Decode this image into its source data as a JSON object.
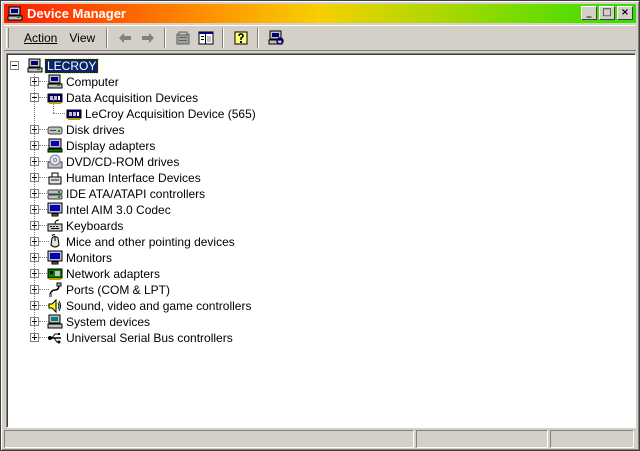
{
  "window": {
    "title": "Device Manager",
    "buttons": {
      "minimize": "_",
      "maximize": "□",
      "close": "×"
    }
  },
  "menu": [
    {
      "label": "Action"
    },
    {
      "label": "View"
    }
  ],
  "toolbar": {
    "tools": [
      "back-arrow-icon",
      "forward-arrow-icon",
      "properties-icon",
      "tree-view-icon",
      "help-icon",
      "scan-hardware-icon"
    ]
  },
  "tree": {
    "root": {
      "label": "LECROY",
      "icon": "computer-icon"
    },
    "items": [
      {
        "label": "Computer",
        "icon": "computer-icon",
        "expanded": false
      },
      {
        "label": "Data Acquisition Devices",
        "icon": "board-icon",
        "expanded": true,
        "children": [
          {
            "label": "LeCroy Acquisition Device (565)",
            "icon": "board-icon"
          }
        ]
      },
      {
        "label": "Disk drives",
        "icon": "disk-drive-icon",
        "expanded": false
      },
      {
        "label": "Display adapters",
        "icon": "display-adapter-icon",
        "expanded": false
      },
      {
        "label": "DVD/CD-ROM drives",
        "icon": "cdrom-icon",
        "expanded": false
      },
      {
        "label": "Human Interface Devices",
        "icon": "hid-icon",
        "expanded": false
      },
      {
        "label": "IDE ATA/ATAPI controllers",
        "icon": "ide-controller-icon",
        "expanded": false
      },
      {
        "label": "Intel AIM 3.0 Codec",
        "icon": "monitor-icon",
        "expanded": false
      },
      {
        "label": "Keyboards",
        "icon": "keyboard-icon",
        "expanded": false
      },
      {
        "label": "Mice and other pointing devices",
        "icon": "mouse-icon",
        "expanded": false
      },
      {
        "label": "Monitors",
        "icon": "monitor-icon",
        "expanded": false
      },
      {
        "label": "Network adapters",
        "icon": "network-adapter-icon",
        "expanded": false
      },
      {
        "label": "Ports (COM & LPT)",
        "icon": "port-icon",
        "expanded": false
      },
      {
        "label": "Sound, video and game controllers",
        "icon": "sound-icon",
        "expanded": false
      },
      {
        "label": "System devices",
        "icon": "system-device-icon",
        "expanded": false
      },
      {
        "label": "Universal Serial Bus controllers",
        "icon": "usb-icon",
        "expanded": false
      }
    ]
  },
  "statusbar": {
    "panes": [
      "",
      "",
      ""
    ]
  },
  "colors": {
    "selection": "#0a246a",
    "face": "#d4d0c8",
    "title_gradient": [
      "#ff1a00",
      "#f6d000",
      "#2ee000"
    ]
  }
}
